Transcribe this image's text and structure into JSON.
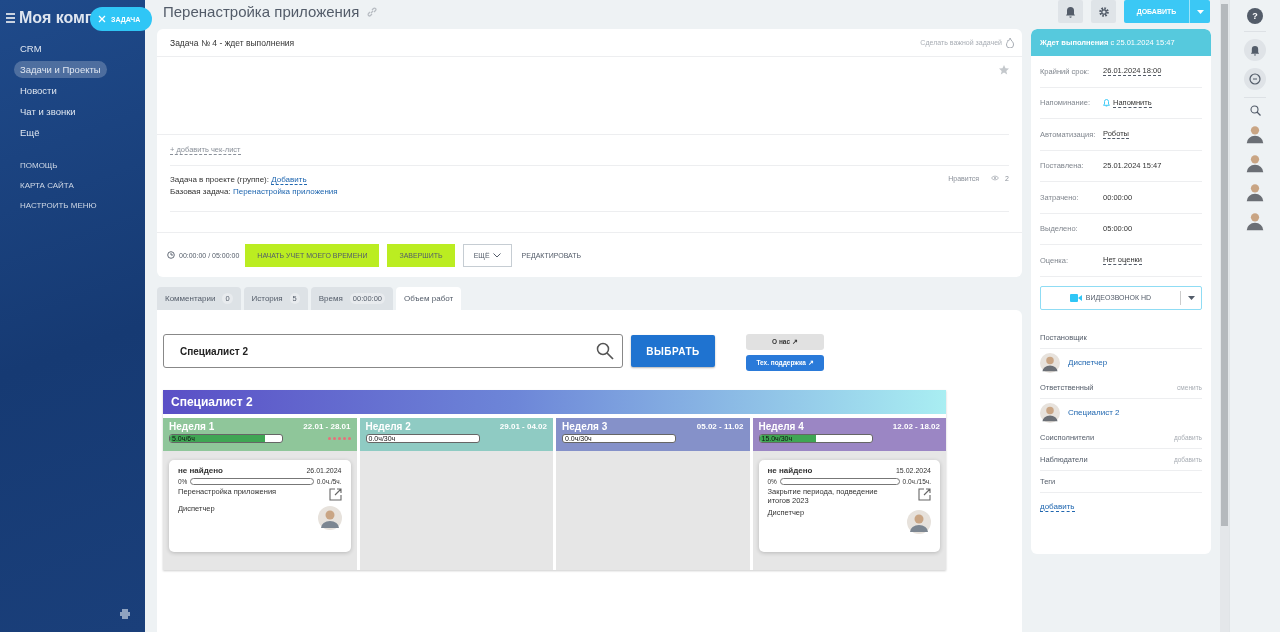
{
  "sidebar": {
    "title": "Моя комп",
    "task_button": "ЗАДАЧА",
    "items": [
      {
        "label": "CRM",
        "selected": false
      },
      {
        "label": "Задачи и Проекты",
        "selected": true
      },
      {
        "label": "Новости",
        "selected": false
      },
      {
        "label": "Чат и звонки",
        "selected": false
      },
      {
        "label": "Ещё",
        "selected": false
      }
    ],
    "links": [
      "ПОМОЩЬ",
      "КАРТА САЙТА",
      "НАСТРОИТЬ МЕНЮ"
    ]
  },
  "header": {
    "title": "Перенастройка приложения",
    "add_button": "ДОБАВИТЬ"
  },
  "task": {
    "heading": "Задача № 4 - ждет выполнения",
    "important_link": "Сделать важной задачей",
    "checklist_link": "+ добавить чек-лист",
    "project_label": "Задача в проекте (группе):",
    "project_link": "Добавить",
    "base_label": "Базовая задача:",
    "base_link": "Перенастройка приложения",
    "like": "Нравится",
    "views": "2",
    "timer": "00:00:00 / 05:00:00",
    "start_button": "НАЧАТЬ УЧЕТ МОЕГО ВРЕМЕНИ",
    "finish_button": "ЗАВЕРШИТЬ",
    "more_button": "ЕЩЁ",
    "edit_button": "РЕДАКТИРОВАТЬ"
  },
  "tabs": [
    {
      "label": "Комментарии",
      "count": "0",
      "selected": false
    },
    {
      "label": "История",
      "count": "5",
      "selected": false
    },
    {
      "label": "Время",
      "count": "00:00:00",
      "selected": false
    },
    {
      "label": "Объем работ",
      "selected": true
    }
  ],
  "workload": {
    "search": {
      "value": "Специалист 2"
    },
    "select_button": "ВЫБРАТЬ",
    "about_button": "О нас ↗",
    "support_button": "Тех. поддержка ↗",
    "banner": "Специалист 2",
    "weeks": [
      {
        "name": "Неделя 1",
        "dates": "22.01 - 28.01",
        "color": "#8fc69a",
        "level": 0.85,
        "reading": "5.0ч/6ч",
        "stars": 5,
        "cards": [
          {
            "title": "не найдено",
            "date": "26.01.2024",
            "percent": "0%",
            "level": 0,
            "hours": "0.0ч./5ч.",
            "task": "Перенастройка приложения",
            "person": "Диспетчер"
          }
        ]
      },
      {
        "name": "Неделя 2",
        "dates": "29.01 - 04.02",
        "color": "#8fcbc3",
        "level": 0,
        "reading": "0.0ч/30ч"
      },
      {
        "name": "Неделя 3",
        "dates": "05.02 - 11.02",
        "color": "#8591c9",
        "level": 0,
        "reading": "0.0ч/30ч"
      },
      {
        "name": "Неделя 4",
        "dates": "12.02 - 18.02",
        "color": "#9b86c4",
        "level": 0.5,
        "reading": "15.0ч/30ч",
        "cards": [
          {
            "title": "не найдено",
            "date": "15.02.2024",
            "percent": "0%",
            "level": 0,
            "hours": "0.0ч./15ч.",
            "task": "Закрытие периода, подведение итогов 2023",
            "person": "Диспетчер"
          }
        ]
      }
    ]
  },
  "details": {
    "status": "**Ждет выполнения** с 25.01.2024 15:47",
    "fields": [
      {
        "label": "Крайний срок:",
        "value": "26.01.2024 18:00",
        "kind": "dotted"
      },
      {
        "label": "Напоминание:",
        "value": "Напомнить",
        "kind": "bell"
      },
      {
        "label": "Автоматизация:",
        "value": "Роботы",
        "kind": "dotted"
      },
      {
        "label": "Поставлена:",
        "value": "25.01.2024 15:47",
        "kind": "plain"
      },
      {
        "label": "Затрачено:",
        "value": "00:00:00",
        "kind": "plain"
      },
      {
        "label": "Выделено:",
        "value": "05:00:00",
        "kind": "plain"
      },
      {
        "label": "Оценка:",
        "value": "Нет оценки",
        "kind": "dotted"
      }
    ],
    "video_button": "ВИДЕОЗВОНОК HD",
    "roles": [
      {
        "label": "Постановщик",
        "person": "Диспетчер"
      },
      {
        "label": "Ответственный",
        "action": "сменить",
        "person": "Специалист 2"
      },
      {
        "label": "Соисполнители",
        "action": "добавить"
      },
      {
        "label": "Наблюдатели",
        "action": "добавить"
      },
      {
        "label": "Теги",
        "link": "добавить"
      }
    ]
  },
  "right_bar": {
    "help": "?"
  }
}
